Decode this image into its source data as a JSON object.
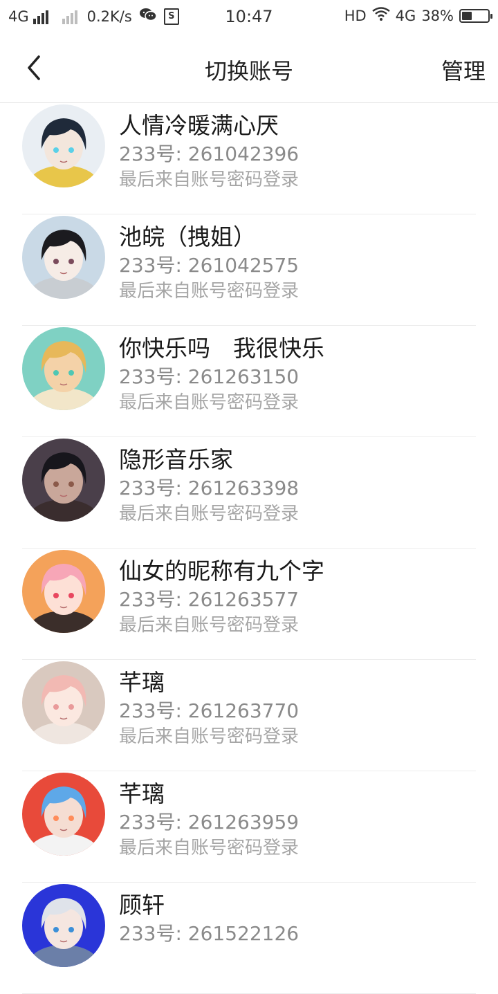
{
  "status_bar": {
    "network": "4G",
    "speed": "0.2K/s",
    "time": "10:47",
    "hd": "HD",
    "network2": "4G",
    "battery": "38%",
    "battery_level": 0.38
  },
  "header": {
    "title": "切换账号",
    "manage_label": "管理"
  },
  "accounts": [
    {
      "name": "人情冷暖满心厌",
      "uid": "233号: 261042396",
      "login": "最后来自账号密码登录"
    },
    {
      "name": "池皖（拽姐）",
      "uid": "233号: 261042575",
      "login": "最后来自账号密码登录"
    },
    {
      "name": "你快乐吗　我很快乐",
      "uid": "233号: 261263150",
      "login": "最后来自账号密码登录"
    },
    {
      "name": "隐形音乐家",
      "uid": "233号: 261263398",
      "login": "最后来自账号密码登录"
    },
    {
      "name": "仙女的昵称有九个字",
      "uid": "233号: 261263577",
      "login": "最后来自账号密码登录"
    },
    {
      "name": "芊璃",
      "uid": "233号: 261263770",
      "login": "最后来自账号密码登录"
    },
    {
      "name": "芊璃",
      "uid": "233号: 261263959",
      "login": "最后来自账号密码登录"
    },
    {
      "name": "顾轩",
      "uid": "233号: 261522126",
      "login": ""
    }
  ],
  "colors": {
    "text_primary": "#1a1a1a",
    "text_secondary": "#8a8a8a",
    "text_tertiary": "#a6a6a6",
    "divider": "#ececec"
  }
}
